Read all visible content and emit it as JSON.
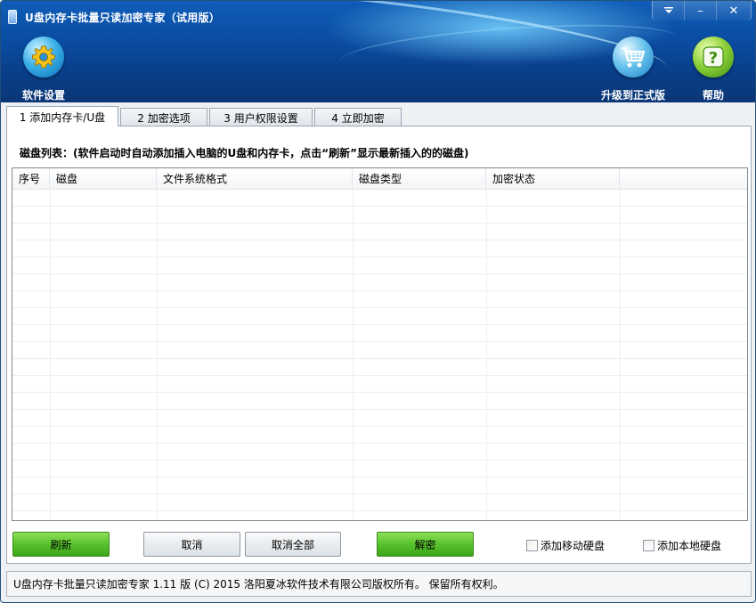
{
  "window": {
    "title": "U盘内存卡批量只读加密专家（试用版）",
    "controls": {
      "menu_icon": "dropdown-icon",
      "minimize": "–",
      "close": "✕"
    }
  },
  "toolbar": {
    "settings_label": "软件设置",
    "upgrade_label": "升级到正式版",
    "help_label": "帮助",
    "help_glyph": "?"
  },
  "tabs": [
    {
      "label": "1 添加内存卡/U盘",
      "active": true
    },
    {
      "label": "2 加密选项",
      "active": false
    },
    {
      "label": "3 用户权限设置",
      "active": false
    },
    {
      "label": "4 立即加密",
      "active": false
    }
  ],
  "disk_list": {
    "heading": "磁盘列表：(软件启动时自动添加插入电脑的U盘和内存卡，点击“刷新”显示最新插入的的磁盘)",
    "columns": [
      "序号",
      "磁盘",
      "文件系统格式",
      "磁盘类型",
      "加密状态",
      ""
    ],
    "rows": []
  },
  "actions": {
    "refresh": "刷新",
    "cancel": "取消",
    "cancel_all": "取消全部",
    "decrypt": "解密",
    "add_mobile_disk": "添加移动硬盘",
    "add_local_disk": "添加本地硬盘"
  },
  "checkboxes": {
    "add_mobile_disk_checked": false,
    "add_local_disk_checked": false
  },
  "status": {
    "text": "U盘内存卡批量只读加密专家 1.11 版 (C) 2015 洛阳夏冰软件技术有限公司版权所有。 保留所有权利。"
  },
  "colors": {
    "header_blue": "#0a4ea5",
    "button_green": "#57c22b",
    "border_gray": "#9aa7b5"
  }
}
